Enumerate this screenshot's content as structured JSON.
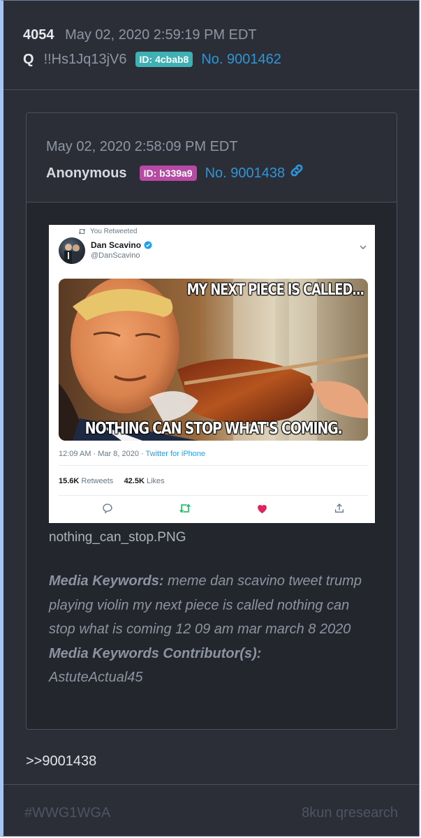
{
  "post": {
    "number": "4054",
    "timestamp": "May 02, 2020 2:59:19 PM EDT",
    "author": "Q",
    "tripcode": "!!Hs1Jq13jV6",
    "id_badge": "ID: 4cbab8",
    "post_no": "No. 9001462",
    "reply_text": ">>9001438"
  },
  "quoted": {
    "timestamp": "May 02, 2020 2:58:09 PM EDT",
    "author": "Anonymous",
    "id_badge": "ID: b339a9",
    "post_no": "No. 9001438",
    "filename": "nothing_can_stop.PNG",
    "keywords_label": "Media Keywords:",
    "keywords_text": " meme dan scavino tweet trump playing violin my next piece is called nothing can stop what is coming 12 09 am mar march 8 2020",
    "contributors_label": "Media Keywords Contributor(s):",
    "contributors_text": "AstuteActual45"
  },
  "tweet": {
    "retweet_note": "You Retweeted",
    "name": "Dan Scavino",
    "handle": "@DanScavino",
    "meme_top_caption": "MY NEXT PIECE IS CALLED...",
    "meme_bottom_caption": "NOTHING CAN STOP WHAT'S COMING.",
    "time": "12:09 AM · Mar 8, 2020 · ",
    "source": "Twitter for iPhone",
    "retweets_count": "15.6K",
    "retweets_label": " Retweets",
    "likes_count": "42.5K",
    "likes_label": " Likes"
  },
  "footer": {
    "hashtag": "#WWG1WGA",
    "board": "8kun qresearch"
  },
  "colors": {
    "id_badge_q": "#3fb1b5",
    "id_badge_anon": "#b64aa5",
    "link": "#2f95d6",
    "like_heart": "#e0245e",
    "retweet_green": "#17bf63"
  }
}
